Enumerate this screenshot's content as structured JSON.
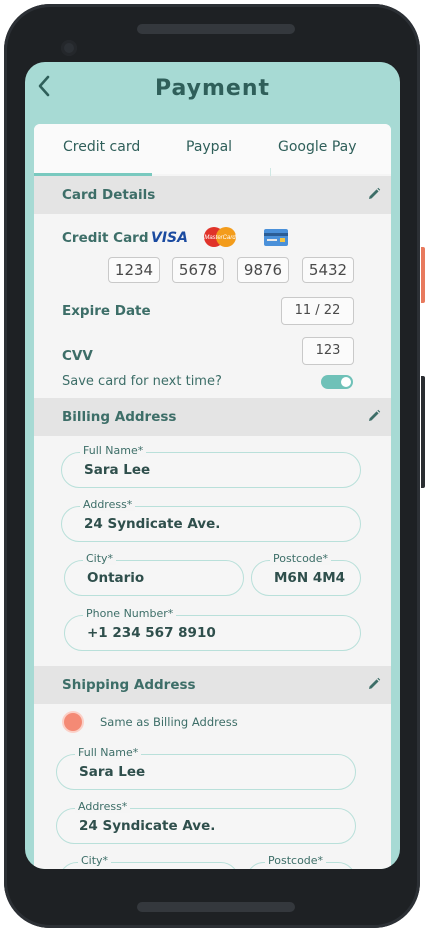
{
  "header": {
    "title": "Payment",
    "back_icon": "chevron-left-icon"
  },
  "tabs": [
    {
      "label": "Credit card",
      "active": true
    },
    {
      "label": "Paypal",
      "active": false
    },
    {
      "label": "Google Pay",
      "active": false
    }
  ],
  "card_details": {
    "section_title": "Card Details",
    "credit_card_label": "Credit Card",
    "visa_text": "VISA",
    "mastercard_text": "MasterCard",
    "card_numbers": [
      "1234",
      "5678",
      "9876",
      "5432"
    ],
    "expire_label": "Expire Date",
    "expire_value": "11 / 22",
    "cvv_label": "CVV",
    "cvv_value": "123",
    "save_card_label": "Save card for next time?",
    "save_card_enabled": true
  },
  "billing": {
    "section_title": "Billing Address",
    "full_name_label": "Full Name*",
    "full_name": "Sara Lee",
    "address_label": "Address*",
    "address": "24 Syndicate Ave.",
    "city_label": "City*",
    "city": "Ontario",
    "postcode_label": "Postcode*",
    "postcode": "M6N 4M4",
    "phone_label": "Phone Number*",
    "phone": "+1 234 567 8910"
  },
  "shipping": {
    "section_title": "Shipping Address",
    "same_as_billing_label": "Same as Billing Address",
    "full_name_label": "Full Name*",
    "full_name": "Sara Lee",
    "address_label": "Address*",
    "address": "24 Syndicate Ave.",
    "city_label": "City*",
    "postcode_label": "Postcode*"
  },
  "colors": {
    "accent": "#79c9bf",
    "header_bg": "#a7dad4",
    "text": "#3d6e68",
    "radio": "#f48a75"
  }
}
